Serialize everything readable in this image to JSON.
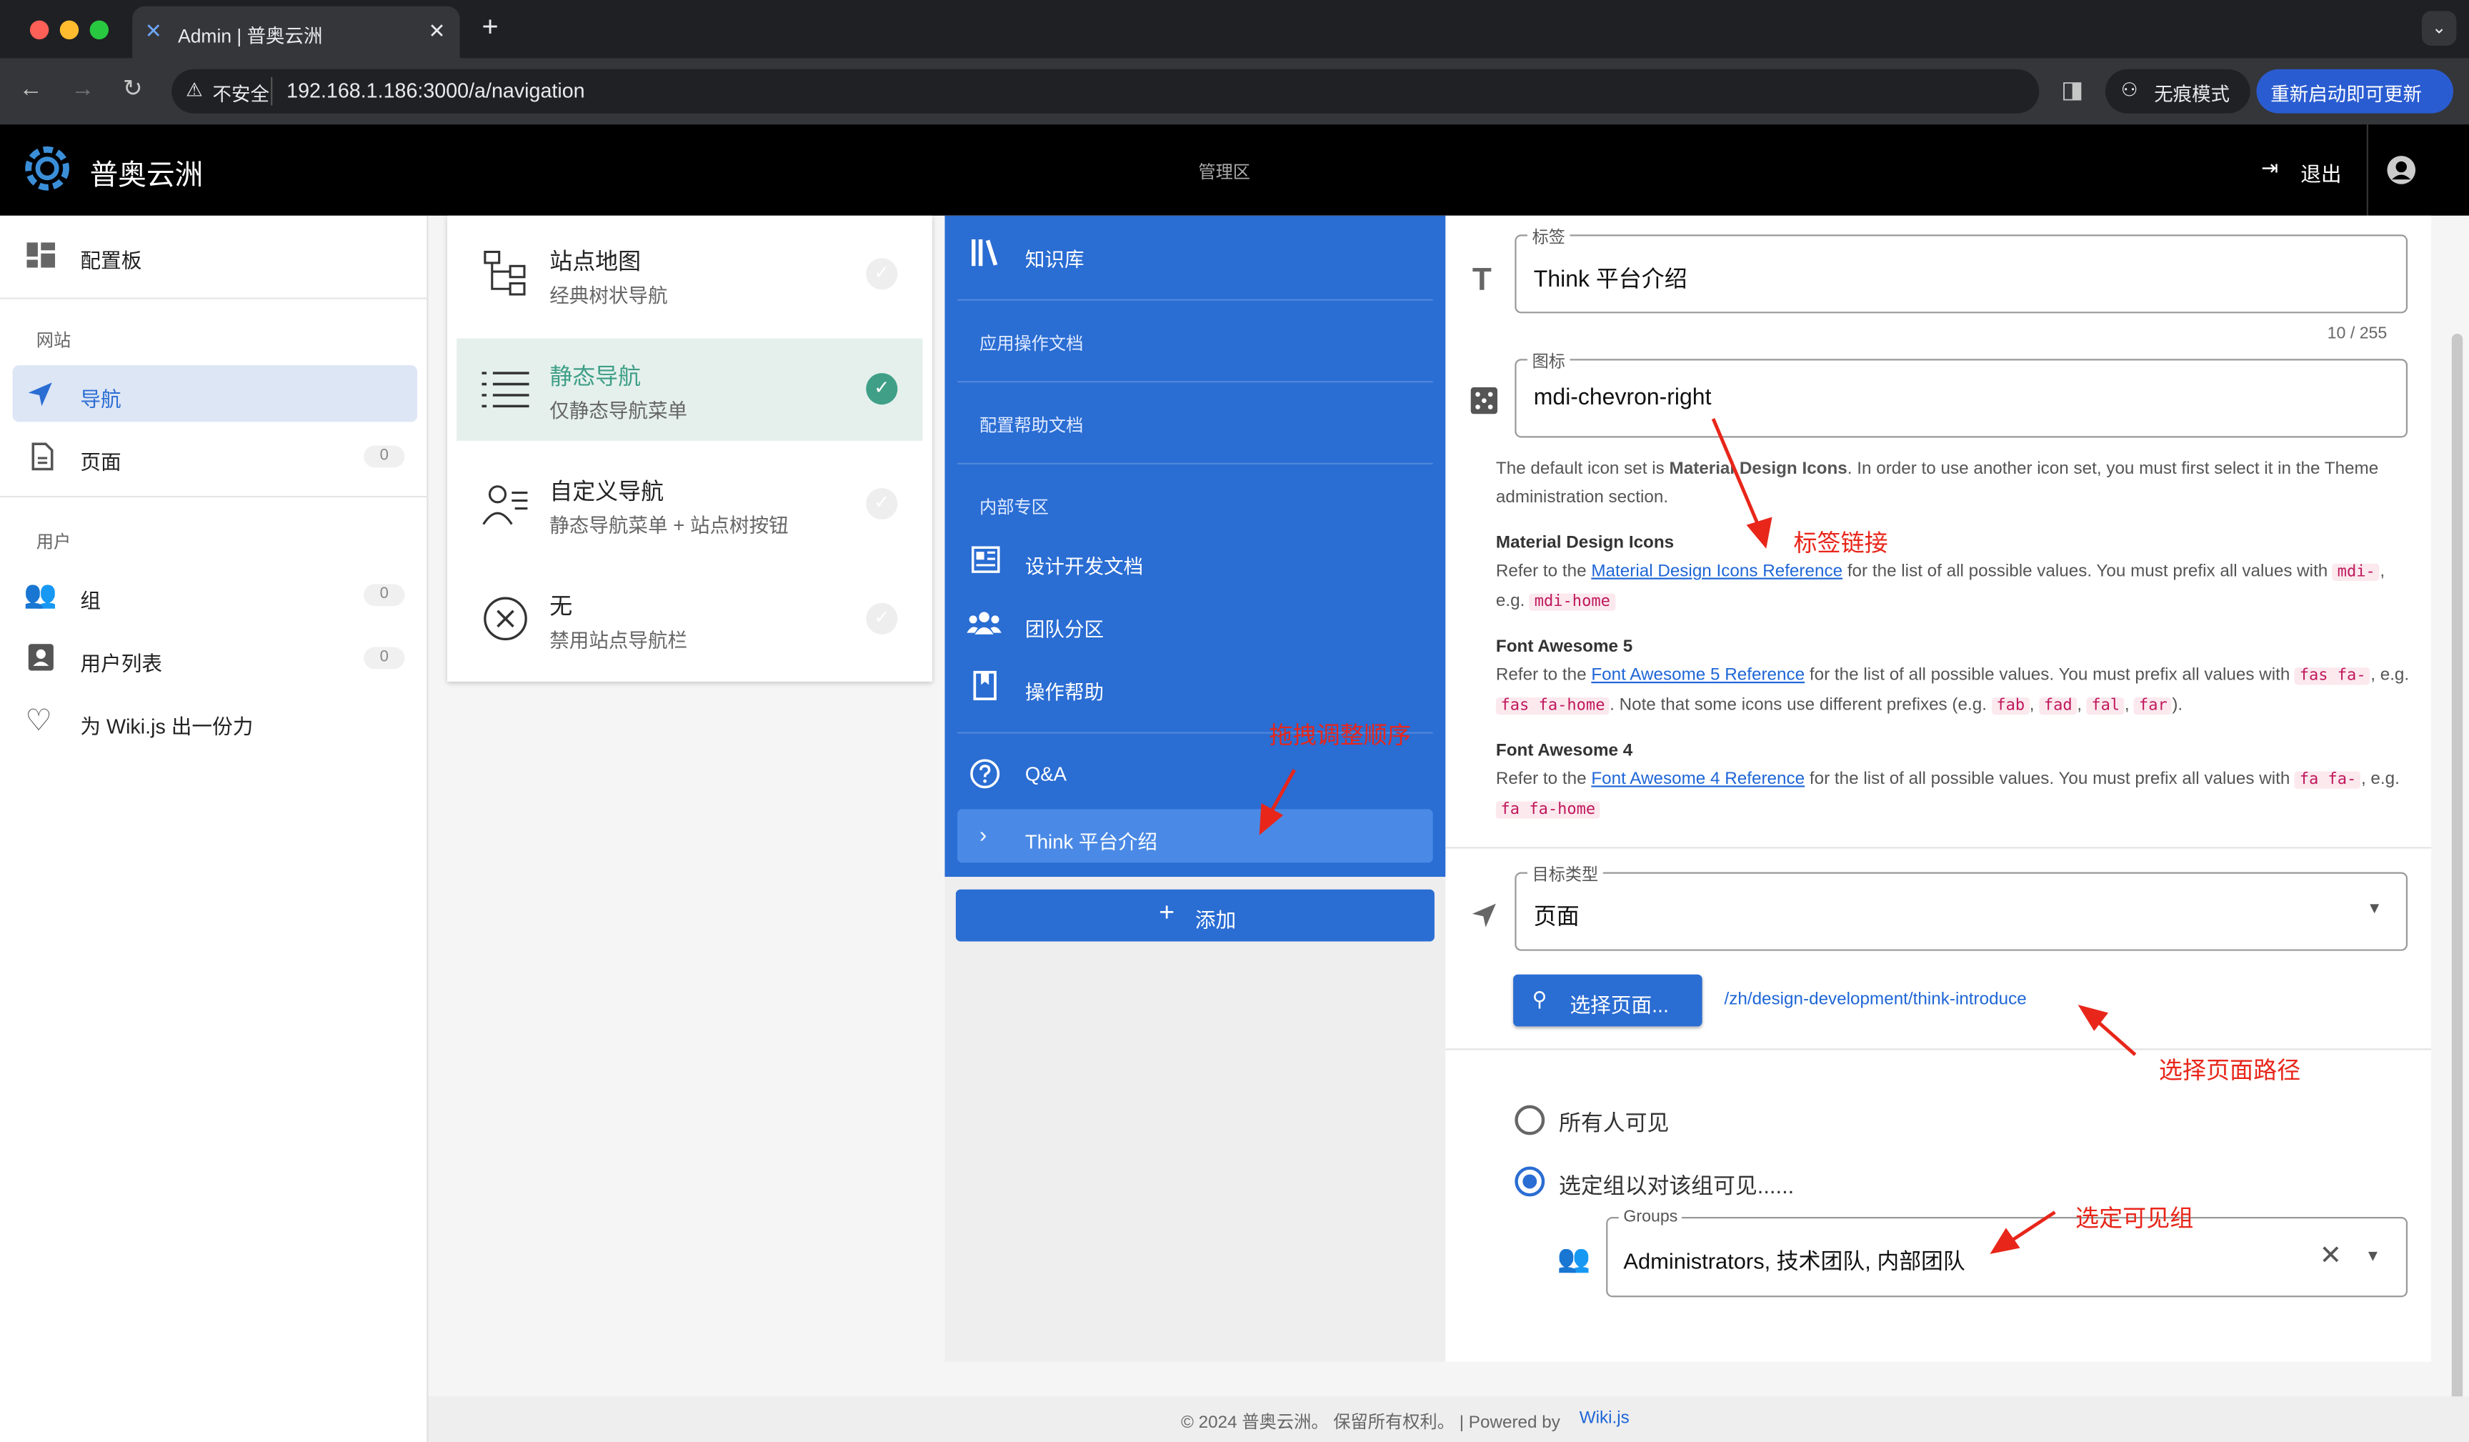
{
  "browser": {
    "tab_title": "Admin | 普奥云洲",
    "security_label": "不安全",
    "url": "192.168.1.186:3000/a/navigation",
    "incognito_label": "无痕模式",
    "update_label": "重新启动即可更新"
  },
  "header": {
    "app_name": "普奥云洲",
    "section": "管理区",
    "logout_label": "退出"
  },
  "sidebar": {
    "dashboard": "配置板",
    "site_section": "网站",
    "nav_label": "导航",
    "pages_label": "页面",
    "pages_count": "0",
    "users_section": "用户",
    "groups_label": "组",
    "groups_count": "0",
    "userlist_label": "用户列表",
    "userlist_count": "0",
    "contribute_label": "为 Wiki.js 出一份力"
  },
  "modes": [
    {
      "title": "站点地图",
      "sub": "经典树状导航",
      "icon": "sitemap-icon",
      "selected": false
    },
    {
      "title": "静态导航",
      "sub": "仅静态导航菜单",
      "icon": "list-icon",
      "selected": true
    },
    {
      "title": "自定义导航",
      "sub": "静态导航菜单 + 站点树按钮",
      "icon": "person-list-icon",
      "selected": false
    },
    {
      "title": "无",
      "sub": "禁用站点导航栏",
      "icon": "close-circle-icon",
      "selected": false
    }
  ],
  "nav": {
    "items": {
      "kb": "知识库",
      "h1": "应用操作文档",
      "h2": "配置帮助文档",
      "h3": "内部专区",
      "design": "设计开发文档",
      "team": "团队分区",
      "help": "操作帮助",
      "qa": "Q&A",
      "think": "Think 平台介绍"
    },
    "add_label": "添加"
  },
  "form": {
    "label_caption": "标签",
    "label_value": "Think 平台介绍",
    "label_counter": "10 / 255",
    "icon_caption": "图标",
    "icon_value": "mdi-chevron-right",
    "icon_help_1": "The default icon set is",
    "icon_help_bold": "Material Design Icons",
    "icon_help_2": ". In order to use another icon set, you must first select it in the Theme administration section.",
    "mdi_title": "Material Design Icons",
    "refer_to": "Refer to the",
    "mdi_link": "Material Design Icons Reference",
    "list_text": "for the list of all possible values. You must prefix all values with",
    "eg": ", e.g.",
    "mdi_prefix": "mdi-",
    "mdi_example": "mdi-home",
    "fa5_title": "Font Awesome 5",
    "fa5_link": "Font Awesome 5 Reference",
    "fa5_prefix": "fas fa-",
    "fa5_example": "fas fa-home",
    "fa5_note": ". Note that some icons use different prefixes (e.g.",
    "fa5_p1": "fab",
    "fa5_p2": "fad",
    "fa5_p3": "fal",
    "fa5_p4": "far",
    "fa5_close": ").",
    "fa4_title": "Font Awesome 4",
    "fa4_link": "Font Awesome 4 Reference",
    "fa4_prefix": "fa fa-",
    "fa4_example": "fa fa-home",
    "target_caption": "目标类型",
    "target_value": "页面",
    "select_page_label": "选择页面...",
    "page_path": "/zh/design-development/think-introduce",
    "vis_all": "所有人可见",
    "vis_groups": "选定组以对该组可见......",
    "groups_caption": "Groups",
    "groups_value": "Administrators, 技术团队, 内部团队"
  },
  "annotations": {
    "label_link": "标签链接",
    "drag": "拖拽调整顺序",
    "choose_path": "选择页面路径",
    "choose_group": "选定可见组"
  },
  "footer": {
    "text": "© 2024 普奥云洲。 保留所有权利。 | Powered by",
    "link": "Wiki.js"
  },
  "colors": {
    "accent_blue": "#2a6dd3",
    "selected_green": "#3f9f87",
    "annotation_red": "#e8261a"
  }
}
